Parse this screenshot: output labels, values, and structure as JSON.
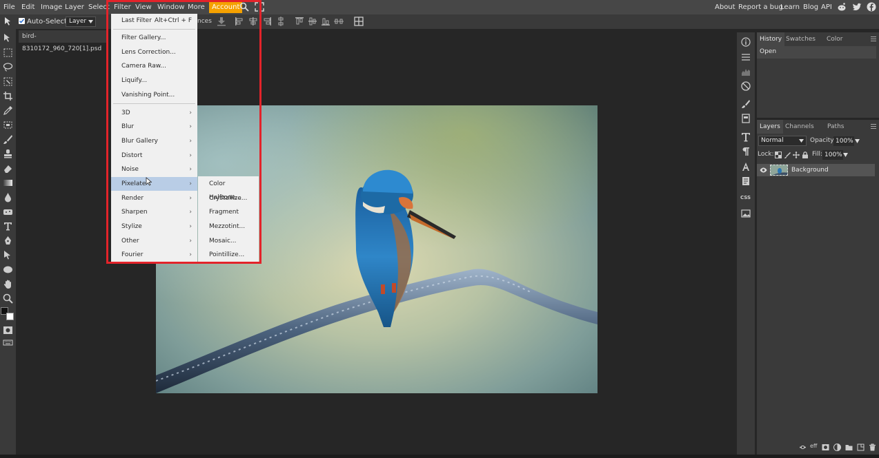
{
  "menubar": {
    "items": [
      "File",
      "Edit",
      "Image",
      "Layer",
      "Select",
      "Filter",
      "View",
      "Window",
      "More",
      "Account"
    ],
    "right_links": [
      "About",
      "Report a bug",
      "Learn",
      "Blog",
      "API"
    ]
  },
  "options": {
    "auto_select_label": "Auto-Select",
    "auto_select_checked": true,
    "target_select": "Layer",
    "partial_label": "nces"
  },
  "document": {
    "tab_title": "bird-8310172_960_720[1].psd"
  },
  "filter_menu": {
    "items": [
      {
        "label": "Last Filter",
        "shortcut": "Alt+Ctrl + F"
      },
      {
        "label": "Filter Gallery..."
      },
      {
        "label": "Lens Correction..."
      },
      {
        "label": "Camera Raw..."
      },
      {
        "label": "Liquify..."
      },
      {
        "label": "Vanishing Point..."
      },
      {
        "label": "3D",
        "submenu": true
      },
      {
        "label": "Blur",
        "submenu": true
      },
      {
        "label": "Blur Gallery",
        "submenu": true
      },
      {
        "label": "Distort",
        "submenu": true
      },
      {
        "label": "Noise",
        "submenu": true
      },
      {
        "label": "Pixelate",
        "submenu": true,
        "highlighted": true
      },
      {
        "label": "Render",
        "submenu": true
      },
      {
        "label": "Sharpen",
        "submenu": true
      },
      {
        "label": "Stylize",
        "submenu": true
      },
      {
        "label": "Other",
        "submenu": true
      },
      {
        "label": "Fourier",
        "submenu": true
      }
    ],
    "arrow_glyph": "›"
  },
  "pixelate_submenu": {
    "items": [
      "Color Halftone...",
      "Crystallize...",
      "Fragment",
      "Mezzotint...",
      "Mosaic...",
      "Pointillize..."
    ]
  },
  "history_panel": {
    "tabs": [
      "History",
      "Swatches",
      "Color"
    ],
    "active_tab": "History",
    "entries": [
      "Open"
    ]
  },
  "layers_panel": {
    "tabs": [
      "Layers",
      "Channels",
      "Paths"
    ],
    "active_tab": "Layers",
    "blend_mode": "Normal",
    "opacity_label": "Opacity:",
    "opacity_value": "100%",
    "lock_label": "Lock:",
    "fill_label": "Fill:",
    "fill_value": "100%",
    "layers": [
      {
        "name": "Background",
        "visible": true
      }
    ]
  },
  "colors": {
    "accent_account": "#f5a100",
    "highlight_frame": "#e3232a",
    "menu_highlight": "#b9cde6"
  },
  "icons": {
    "menubar": [
      "search-icon",
      "fullscreen-icon",
      "reddit-icon",
      "twitter-icon",
      "facebook-icon"
    ],
    "right_minibar": [
      "info-icon",
      "adjustments-icon",
      "histogram-icon",
      "navigator-icon",
      "brush-icon",
      "layers-comp-icon",
      "text-icon",
      "paragraph-icon",
      "glyph-icon",
      "character-icon",
      "css-icon",
      "image-icon"
    ]
  }
}
